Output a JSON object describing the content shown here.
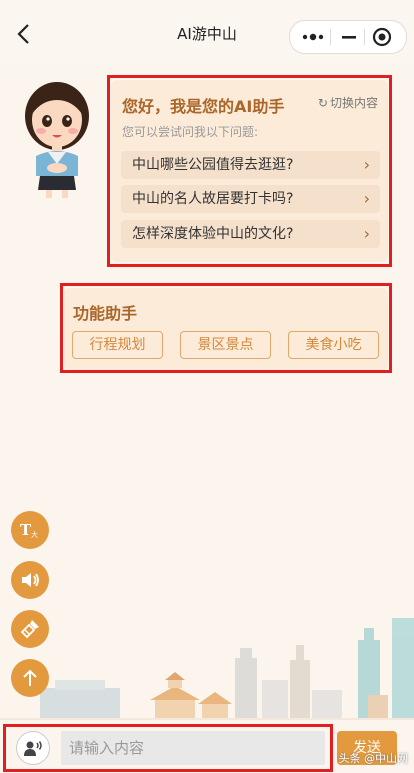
{
  "header": {
    "title": "AI游中山"
  },
  "welcome": {
    "title": "您好，我是您的AI助手",
    "switch_label": "切换内容",
    "subtitle": "您可以尝试问我以下问题:",
    "questions": [
      {
        "text": "中山哪些公园值得去逛逛?"
      },
      {
        "text": "中山的名人故居要打卡吗?"
      },
      {
        "text": "怎样深度体验中山的文化?"
      }
    ]
  },
  "functions": {
    "title": "功能助手",
    "buttons": [
      {
        "label": "行程规划"
      },
      {
        "label": "景区景点"
      },
      {
        "label": "美食小吃"
      }
    ]
  },
  "tools": [
    {
      "icon": "text-size-icon"
    },
    {
      "icon": "speaker-icon"
    },
    {
      "icon": "broom-icon"
    },
    {
      "icon": "arrow-up-icon"
    }
  ],
  "input": {
    "placeholder": "请输入内容",
    "value": ""
  },
  "send_label": "发送",
  "watermark": "头条 @中山网",
  "colors": {
    "accent": "#e39a3f",
    "card_bg": "#fdebd9",
    "title_brown": "#a9672a",
    "highlight_red": "#e02020"
  }
}
